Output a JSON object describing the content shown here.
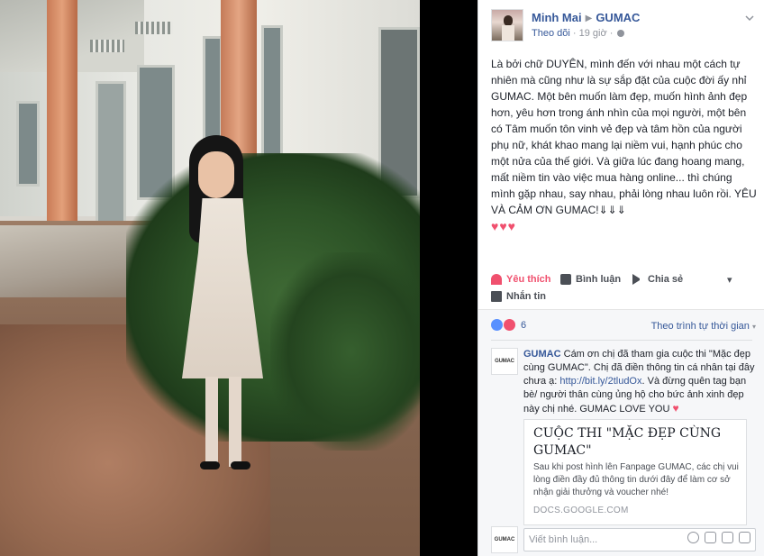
{
  "post": {
    "author": "Minh Mai",
    "arrow": "▶",
    "page": "GUMAC",
    "follow": "Theo dõi",
    "dot": "·",
    "time": "19 giờ",
    "body": "Là bởi chữ DUYÊN, mình đến với nhau một cách tự nhiên mà cũng như là sự sắp đặt của cuộc đời ấy nhỉ GUMAC. Một bên muốn làm đẹp, muốn hình ảnh đẹp hơn, yêu hơn trong ánh nhìn của mọi người, một bên có Tâm muốn tôn vinh vẻ đẹp và tâm hồn của người phụ nữ, khát khao mang lại niềm vui, hạnh phúc cho một nửa của thế giới. Và giữa lúc đang hoang mang, mất niềm tin vào việc mua hàng online... thì chúng mình gặp nhau, say nhau, phải lòng nhau luôn rồi. YÊU VÀ CẢM ƠN GUMAC!⇓⇓⇓",
    "hearts": "♥♥♥"
  },
  "actions": {
    "like": "Yêu thích",
    "comment": "Bình luận",
    "share": "Chia sẻ",
    "message": "Nhắn tin",
    "more": "▾"
  },
  "reactions": {
    "count": "6",
    "sort": "Theo trình tự thời gian",
    "sort_caret": "▾"
  },
  "comment": {
    "avatar_text": "GUMAC",
    "author": "GUMAC",
    "text_1": "Cám ơn chị đã tham gia cuộc thi \"Mặc đẹp cùng GUMAC\". Chị đã điền thông tin cá nhân tại đây chưa ạ: ",
    "link": "http://bit.ly/2tludOx",
    "text_2": ". Và đừng quên tag bạn bè/ người thân cùng ủng hộ cho bức ảnh xinh đẹp này chị nhé. GUMAC LOVE YOU ",
    "heart": "♥"
  },
  "attachment": {
    "title": "CUỘC THI \"MẶC ĐẸP CÙNG GUMAC\"",
    "description": "Sau khi post hình lên Fanpage GUMAC, các chị vui lòng điền đầy đủ thông tin dưới đây để làm cơ sở nhận giải thưởng và voucher nhé!",
    "source": "DOCS.GOOGLE.COM"
  },
  "reply": {
    "avatar_text": "GUMAC",
    "placeholder": "Viết bình luận...",
    "icons": [
      "emoji-icon",
      "camera-icon",
      "gif-icon",
      "sticker-icon"
    ]
  },
  "colors": {
    "link": "#365899",
    "love": "#f0506e",
    "like": "#5890ff"
  }
}
